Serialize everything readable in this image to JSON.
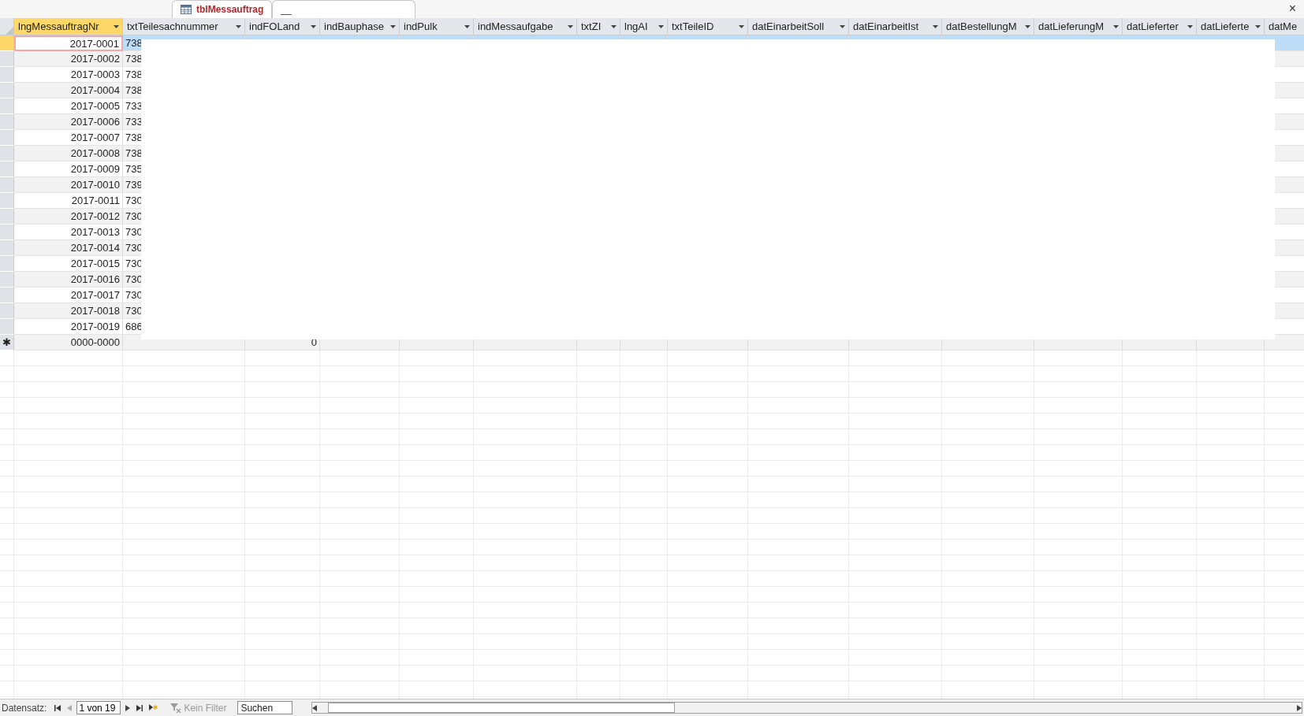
{
  "tabs": [
    {
      "label": "tblMessauftrag",
      "selected": true
    },
    {
      "label": "__",
      "selected": false
    }
  ],
  "close_button": "×",
  "table": {
    "columns": [
      {
        "label": "lngMessauftragNr",
        "selected": true
      },
      {
        "label": "txtTeilesachnummer",
        "selected": false
      },
      {
        "label": "indFOLand",
        "selected": false
      },
      {
        "label": "indBauphase",
        "selected": false
      },
      {
        "label": "indPulk",
        "selected": false
      },
      {
        "label": "indMessaufgabe",
        "selected": false
      },
      {
        "label": "txtZI",
        "selected": false
      },
      {
        "label": "lngAI",
        "selected": false
      },
      {
        "label": "txtTeileID",
        "selected": false
      },
      {
        "label": "datEinarbeitSoll",
        "selected": false
      },
      {
        "label": "datEinarbeitIst",
        "selected": false
      },
      {
        "label": "datBestellungM",
        "selected": false
      },
      {
        "label": "datLieferungM",
        "selected": false
      },
      {
        "label": "datLieferter",
        "selected": false
      },
      {
        "label": "datLieferte",
        "selected": false
      },
      {
        "label": "datMe",
        "selected": false
      }
    ],
    "rows": [
      {
        "selected": true,
        "cells": [
          "2017-0001",
          "738"
        ]
      },
      {
        "selected": false,
        "cells": [
          "2017-0002",
          "738"
        ]
      },
      {
        "selected": false,
        "cells": [
          "2017-0003",
          "738"
        ]
      },
      {
        "selected": false,
        "cells": [
          "2017-0004",
          "738"
        ]
      },
      {
        "selected": false,
        "cells": [
          "2017-0005",
          "733"
        ]
      },
      {
        "selected": false,
        "cells": [
          "2017-0006",
          "733"
        ]
      },
      {
        "selected": false,
        "cells": [
          "2017-0007",
          "738"
        ]
      },
      {
        "selected": false,
        "cells": [
          "2017-0008",
          "738"
        ]
      },
      {
        "selected": false,
        "cells": [
          "2017-0009",
          "735"
        ]
      },
      {
        "selected": false,
        "cells": [
          "2017-0010",
          "739"
        ]
      },
      {
        "selected": false,
        "cells": [
          "2017-0011",
          "730"
        ]
      },
      {
        "selected": false,
        "cells": [
          "2017-0012",
          "730"
        ]
      },
      {
        "selected": false,
        "cells": [
          "2017-0013",
          "730"
        ]
      },
      {
        "selected": false,
        "cells": [
          "2017-0014",
          "730"
        ]
      },
      {
        "selected": false,
        "cells": [
          "2017-0015",
          "730"
        ]
      },
      {
        "selected": false,
        "cells": [
          "2017-0016",
          "730"
        ]
      },
      {
        "selected": false,
        "cells": [
          "2017-0017",
          "730"
        ]
      },
      {
        "selected": false,
        "cells": [
          "2017-0018",
          "730"
        ]
      },
      {
        "selected": false,
        "cells": [
          "2017-0019",
          "686"
        ]
      }
    ],
    "new_row": {
      "marker": "✱",
      "column_1": "0000-0000",
      "column_3": "0"
    }
  },
  "status_bar": {
    "label": "Datensatz:",
    "position": "1 von 19",
    "filter": {
      "label": "Kein Filter",
      "disabled": true
    },
    "search": {
      "placeholder": "Suchen"
    }
  }
}
